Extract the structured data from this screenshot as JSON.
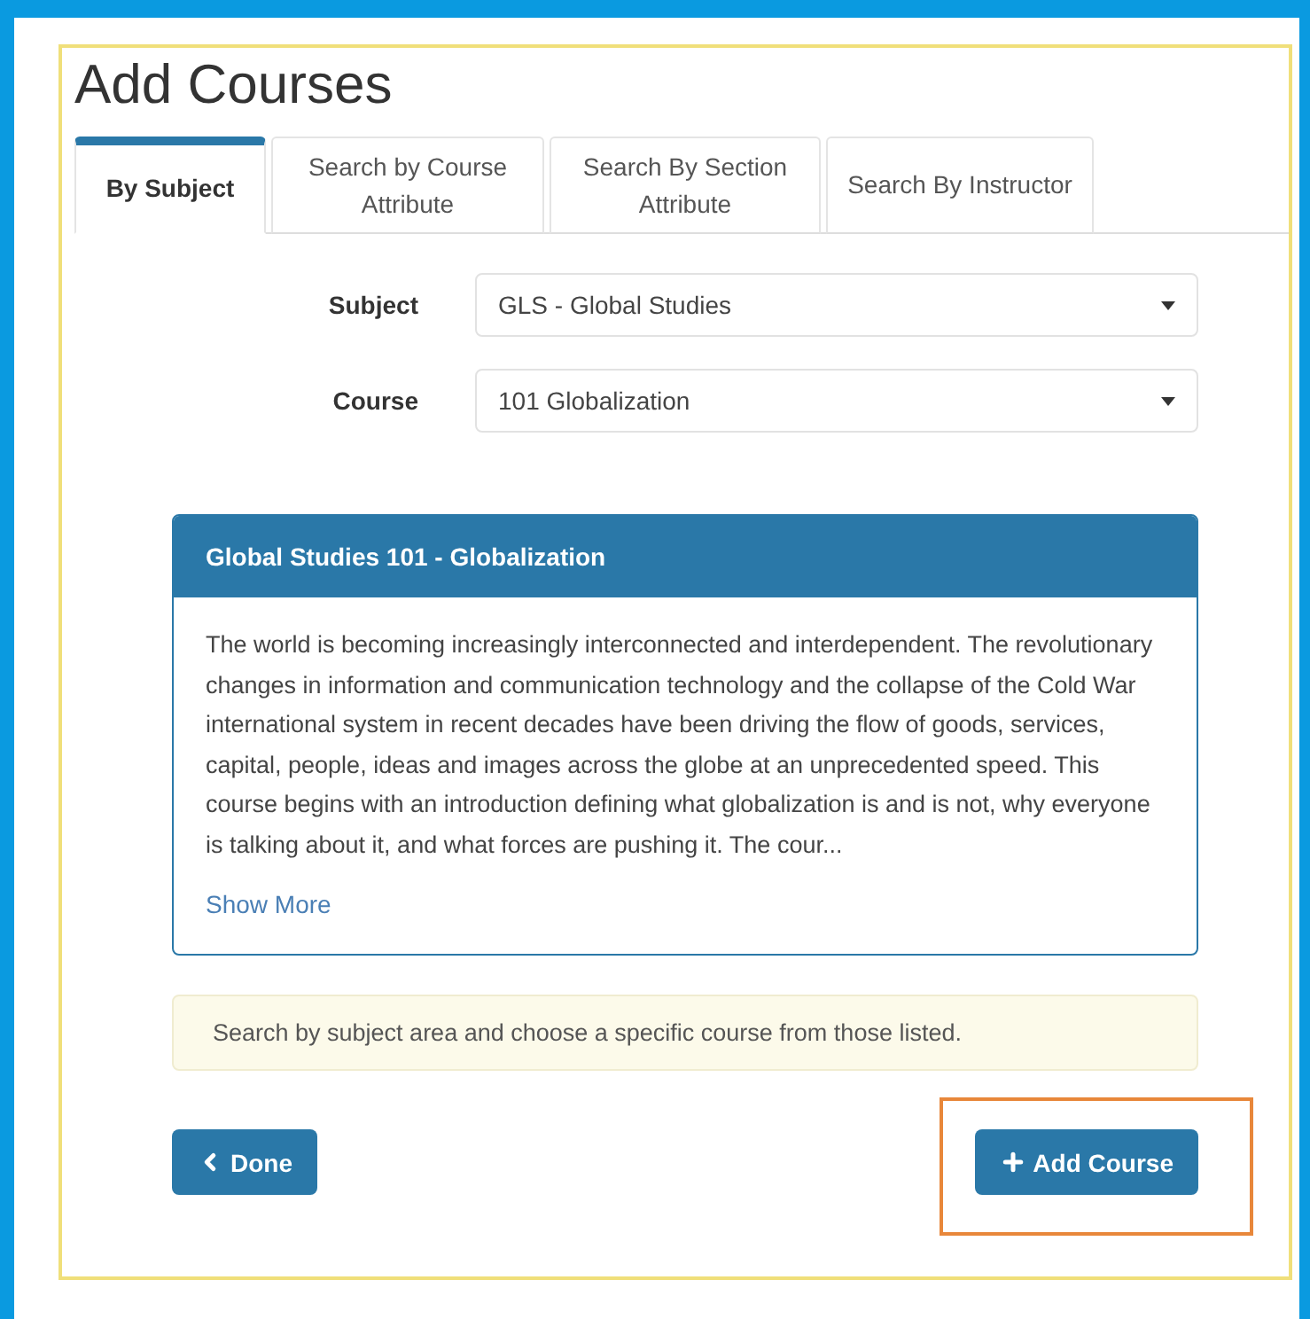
{
  "title": "Add Courses",
  "tabs": [
    {
      "label": "By Subject",
      "selected": true
    },
    {
      "label": "Search by Course Attribute",
      "selected": false
    },
    {
      "label": "Search By Section Attribute",
      "selected": false
    },
    {
      "label": "Search By Instructor",
      "selected": false
    }
  ],
  "fields": [
    {
      "label": "Subject",
      "value": "GLS - Global Studies"
    },
    {
      "label": "Course",
      "value": "101 Globalization"
    }
  ],
  "course_card": {
    "title": "Global Studies 101 - Globalization",
    "description": "The world is becoming increasingly interconnected and interdependent. The revolutionary changes in information and communication technology and the collapse of the Cold War international system in recent decades have been driving the flow of goods, services, capital, people, ideas and images across the globe at an unprecedented speed. This course begins with an introduction defining what globalization is and is not, why everyone is talking about it, and what forces are pushing it. The cour...",
    "link": "Show More"
  },
  "hint": "Search by subject area and choose a specific course from those listed.",
  "done_button": {
    "label": "Done"
  },
  "add_button": {
    "label": "Add Course",
    "highlighted": true
  }
}
